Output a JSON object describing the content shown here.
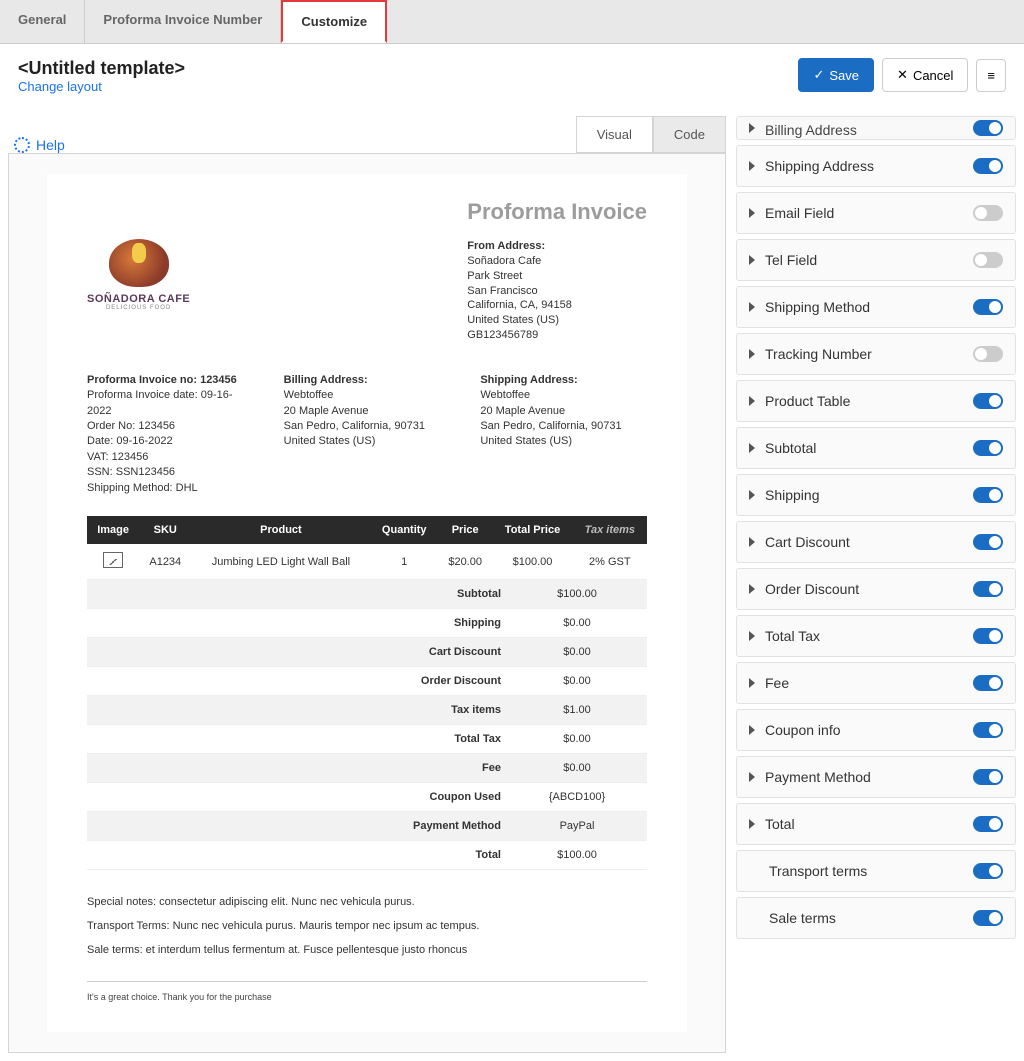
{
  "tabs": {
    "general": "General",
    "pin": "Proforma Invoice Number",
    "customize": "Customize"
  },
  "header": {
    "title": "<Untitled template>",
    "change_layout": "Change layout",
    "save": "Save",
    "cancel": "Cancel"
  },
  "help": "Help",
  "view": {
    "visual": "Visual",
    "code": "Code"
  },
  "doc": {
    "title": "Proforma Invoice",
    "logo_name": "SOÑADORA CAFE",
    "logo_sub": "DELICIOUS FOOD",
    "from": {
      "label": "From Address:",
      "l1": "Soñadora Cafe",
      "l2": "Park Street",
      "l3": "San Francisco",
      "l4": "California, CA, 94158",
      "l5": "United States (US)",
      "l6": "GB123456789"
    },
    "inv": {
      "no_lbl": "Proforma Invoice no: 123456",
      "date": "Proforma Invoice date: 09-16-2022",
      "ord": "Order No: 123456",
      "odate": "Date: 09-16-2022",
      "vat": "VAT: 123456",
      "ssn": "SSN: SSN123456",
      "ship": "Shipping Method: DHL"
    },
    "bill": {
      "label": "Billing Address:",
      "l1": "Webtoffee",
      "l2": "20 Maple Avenue",
      "l3": "San Pedro, California, 90731",
      "l4": "United States (US)"
    },
    "shipaddr": {
      "label": "Shipping Address:",
      "l1": "Webtoffee",
      "l2": "20 Maple Avenue",
      "l3": "San Pedro, California, 90731",
      "l4": "United States (US)"
    },
    "th": {
      "img": "Image",
      "sku": "SKU",
      "prod": "Product",
      "qty": "Quantity",
      "price": "Price",
      "tot": "Total Price",
      "tax": "Tax items"
    },
    "row": {
      "sku": "A1234",
      "prod": "Jumbing LED Light Wall Ball",
      "qty": "1",
      "price": "$20.00",
      "tot": "$100.00",
      "tax": "2% GST"
    },
    "sum": {
      "subtotal_l": "Subtotal",
      "subtotal_v": "$100.00",
      "ship_l": "Shipping",
      "ship_v": "$0.00",
      "cartd_l": "Cart Discount",
      "cartd_v": "$0.00",
      "ordd_l": "Order Discount",
      "ordd_v": "$0.00",
      "taxi_l": "Tax items",
      "taxi_v": "$1.00",
      "ttax_l": "Total Tax",
      "ttax_v": "$0.00",
      "fee_l": "Fee",
      "fee_v": "$0.00",
      "coup_l": "Coupon Used",
      "coup_v": "{ABCD100}",
      "pay_l": "Payment Method",
      "pay_v": "PayPal",
      "tot_l": "Total",
      "tot_v": "$100.00"
    },
    "notes": {
      "n1": "Special notes: consectetur adipiscing elit. Nunc nec vehicula purus.",
      "n2": "Transport Terms: Nunc nec vehicula purus. Mauris tempor nec ipsum ac tempus.",
      "n3": "Sale terms: et interdum tellus fermentum at. Fusce pellentesque justo rhoncus"
    },
    "thanks": "It's a great choice. Thank you for the purchase"
  },
  "opts": {
    "billing": "Billing Address",
    "shipaddr": "Shipping Address",
    "email": "Email Field",
    "tel": "Tel Field",
    "shipm": "Shipping Method",
    "track": "Tracking Number",
    "ptable": "Product Table",
    "subtotal": "Subtotal",
    "ship": "Shipping",
    "cartd": "Cart Discount",
    "ordd": "Order Discount",
    "ttax": "Total Tax",
    "fee": "Fee",
    "coup": "Coupon info",
    "pay": "Payment Method",
    "total": "Total",
    "transport": "Transport terms",
    "sale": "Sale terms"
  }
}
